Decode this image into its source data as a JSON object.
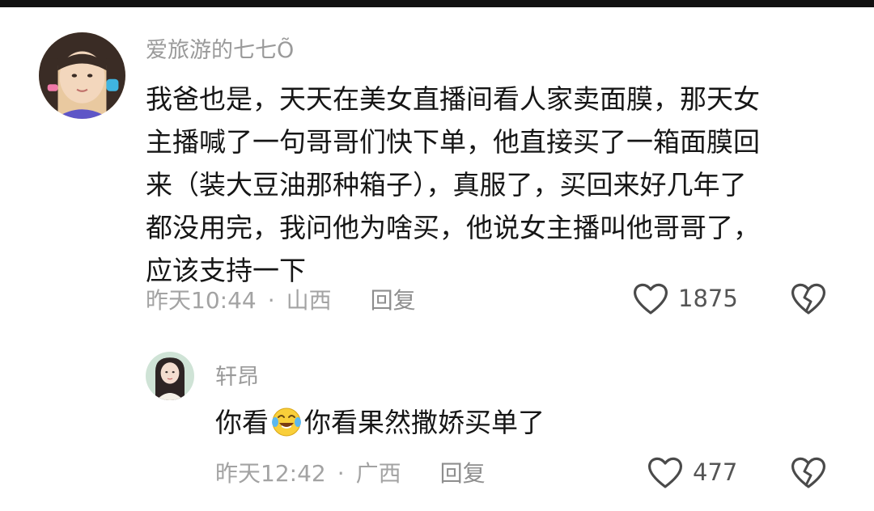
{
  "comments": [
    {
      "username": "爱旅游的七七Õ",
      "content_lines": [
        "我爸也是，天天在美女直播间看人家卖面膜，那天女",
        "主播喊了一句哥哥们快下单，他直接买了一箱面膜回",
        "来（装大豆油那种箱子），真服了，买回来好几年了",
        "都没用完，我问他为啥买，他说女主播叫他哥哥了，",
        "应该支持一下"
      ],
      "time": "昨天10:44",
      "location": "山西",
      "reply_label": "回复",
      "likes": "1875",
      "avatar_icon": "user-avatar"
    },
    {
      "username": "轩昂",
      "content_before": "你看",
      "emoji_icon": "crying-laughing-emoji",
      "content_after": "你看果然撒娇买单了",
      "time": "昨天12:42",
      "location": "广西",
      "reply_label": "回复",
      "likes": "477",
      "avatar_icon": "user-avatar"
    }
  ],
  "separator": "·",
  "icons": {
    "like": "heart-outline-icon",
    "dislike": "broken-heart-icon"
  },
  "colors": {
    "username": "#9a9a9a",
    "meta": "#a3a3a3",
    "text": "#161616",
    "icon": "#4a4a4a"
  }
}
